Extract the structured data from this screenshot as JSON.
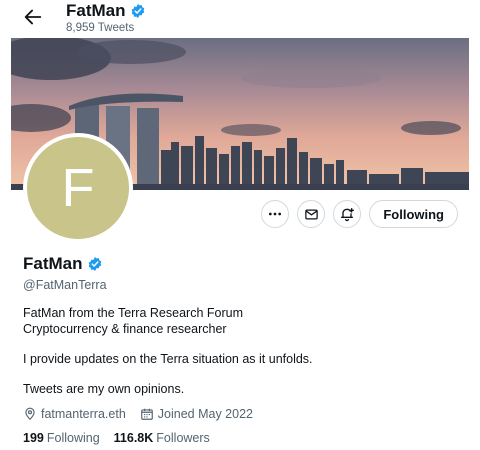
{
  "header": {
    "name": "FatMan",
    "tweets_count": "8,959 Tweets"
  },
  "avatar": {
    "letter": "F",
    "color": "#c8c48a"
  },
  "actions": {
    "follow_label": "Following"
  },
  "profile": {
    "name": "FatMan",
    "handle": "@FatManTerra",
    "bio_lines": [
      "FatMan from the Terra Research Forum",
      "Cryptocurrency & finance researcher",
      "I provide updates on the Terra situation as it unfolds.",
      "Tweets are my own opinions."
    ],
    "website": "fatmanterra.eth",
    "joined": "Joined May 2022",
    "following_count": "199",
    "following_label": "Following",
    "followers_count": "116.8K",
    "followers_label": "Followers"
  },
  "colors": {
    "verified": "#1d9bf0",
    "muted": "#536471"
  },
  "icons": [
    "back-arrow-icon",
    "verified-icon",
    "more-icon",
    "message-icon",
    "notification-bell-icon",
    "location-icon",
    "calendar-icon"
  ]
}
